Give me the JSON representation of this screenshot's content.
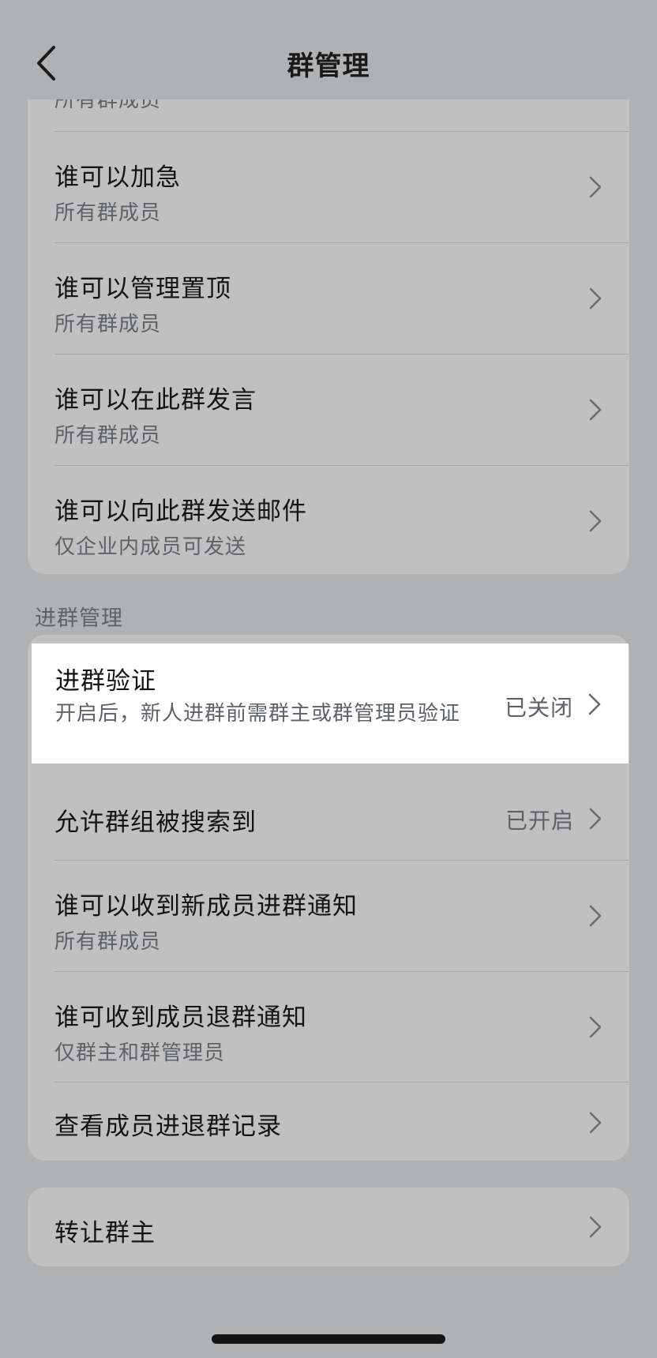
{
  "nav": {
    "title": "群管理",
    "back_icon": "chevron-left-icon"
  },
  "group1": {
    "partial_sub": "所有群成员",
    "rows": [
      {
        "title": "谁可以加急",
        "sub": "所有群成员"
      },
      {
        "title": "谁可以管理置顶",
        "sub": "所有群成员"
      },
      {
        "title": "谁可以在此群发言",
        "sub": "所有群成员"
      },
      {
        "title": "谁可以向此群发送邮件",
        "sub": "仅企业内成员可发送"
      }
    ]
  },
  "section2": {
    "header": "进群管理",
    "verify": {
      "title": "进群验证",
      "sub": "开启后，新人进群前需群主或群管理员验证",
      "value": "已关闭"
    },
    "search": {
      "title": "允许群组被搜索到",
      "value": "已开启"
    },
    "rows": [
      {
        "title": "谁可以收到新成员进群通知",
        "sub": "所有群成员"
      },
      {
        "title": "谁可收到成员退群通知",
        "sub": "仅群主和群管理员"
      }
    ],
    "records": {
      "title": "查看成员进退群记录"
    }
  },
  "group3": {
    "transfer": {
      "title": "转让群主"
    }
  },
  "icons": {
    "row_chevron": "chevron-right-icon"
  }
}
